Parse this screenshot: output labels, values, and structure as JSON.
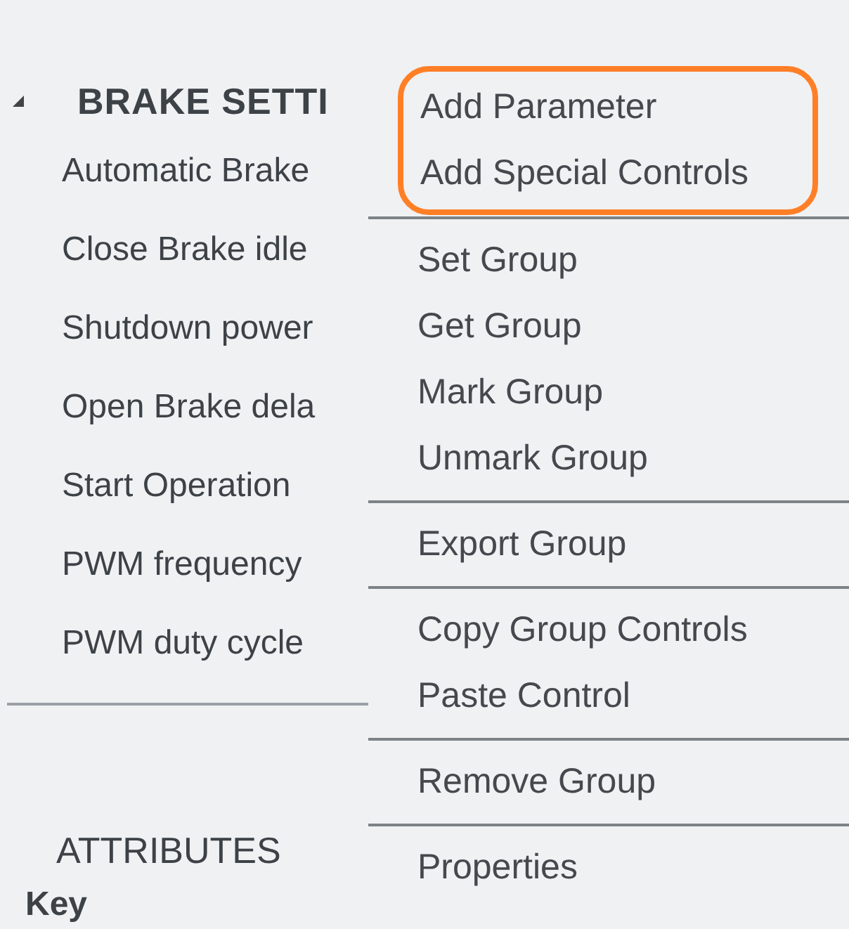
{
  "tree": {
    "title": "BRAKE SETTI",
    "expanded": true,
    "children": [
      {
        "label": "Automatic Brake"
      },
      {
        "label": "Close Brake idle"
      },
      {
        "label": "Shutdown power"
      },
      {
        "label": "Open Brake dela"
      },
      {
        "label": "Start Operation"
      },
      {
        "label": "PWM frequency"
      },
      {
        "label": "PWM duty cycle"
      }
    ]
  },
  "attributes": {
    "title": "ATTRIBUTES",
    "column_1": "Key"
  },
  "context_menu": {
    "sections": [
      {
        "highlighted": true,
        "items": [
          "Add Parameter",
          "Add Special Controls"
        ]
      },
      {
        "highlighted": false,
        "items": [
          "Set Group",
          "Get Group",
          "Mark Group",
          "Unmark Group"
        ]
      },
      {
        "highlighted": false,
        "items": [
          "Export Group"
        ]
      },
      {
        "highlighted": false,
        "items": [
          "Copy Group Controls",
          "Paste Control"
        ]
      },
      {
        "highlighted": false,
        "items": [
          "Remove Group"
        ]
      },
      {
        "highlighted": false,
        "items": [
          "Properties"
        ]
      }
    ]
  }
}
